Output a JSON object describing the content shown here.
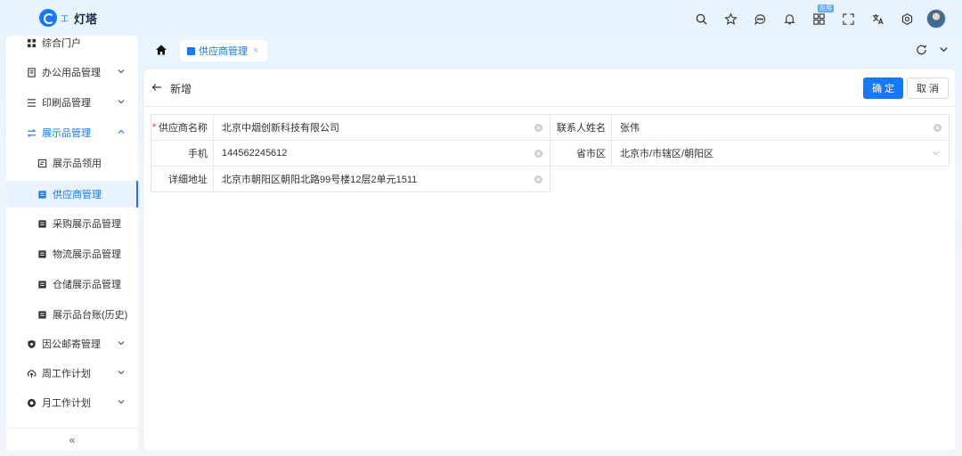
{
  "app": {
    "logo_text": "灯塔",
    "logo_small": "工"
  },
  "topbar": {
    "badge": "应用"
  },
  "sidebar": {
    "items": [
      {
        "label": "综合门户"
      },
      {
        "label": "办公用品管理"
      },
      {
        "label": "印刷品管理"
      },
      {
        "label": "展示品管理"
      },
      {
        "label": "展示品领用"
      },
      {
        "label": "供应商管理"
      },
      {
        "label": "采购展示品管理"
      },
      {
        "label": "物流展示品管理"
      },
      {
        "label": "仓储展示品管理"
      },
      {
        "label": "展示品台账(历史)"
      },
      {
        "label": "因公邮寄管理"
      },
      {
        "label": "周工作计划"
      },
      {
        "label": "月工作计划"
      }
    ],
    "collapse": "«"
  },
  "tabs": [
    {
      "label": "供应商管理",
      "close": "×"
    }
  ],
  "page": {
    "title": "新增",
    "ok": "确 定",
    "cancel": "取 消"
  },
  "form": {
    "supplier_name_label": "供应商名称",
    "supplier_name_value": "北京中烟创新科技有限公司",
    "contact_label": "联系人姓名",
    "contact_value": "张伟",
    "phone_label": "手机",
    "phone_value": "144562245612",
    "region_label": "省市区",
    "region_value": "北京市/市辖区/朝阳区",
    "address_label": "详细地址",
    "address_value": "北京市朝阳区朝阳北路99号楼12层2单元1511"
  },
  "colors": {
    "primary": "#1677ff",
    "required": "#f5222d"
  }
}
